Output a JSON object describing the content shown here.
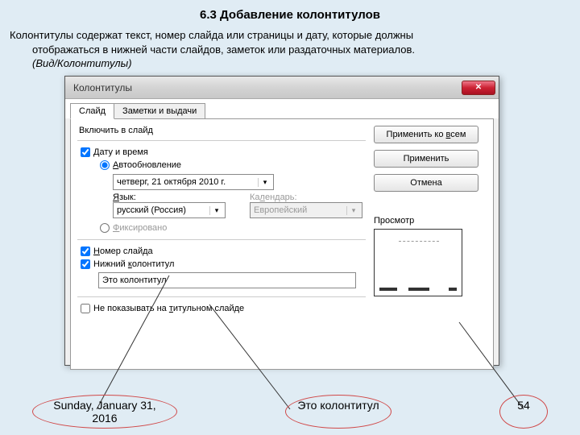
{
  "section_title": "6.3 Добавление колонтитулов",
  "description_line1": "Колонтитулы содержат текст, номер слайда или страницы и дату, которые должны",
  "description_line2": "отображаться в нижней части слайдов, заметок или раздаточных материалов.",
  "description_line3": "(Вид/Колонтитулы)",
  "dialog": {
    "title": "Колонтитулы",
    "tabs": {
      "slide": "Слайд",
      "notes": "Заметки и выдачи"
    },
    "include_label": "Включить в слайд",
    "date_time_label": "Дату и время",
    "auto_label": "Автообновление",
    "date_value": "четверг, 21 октября 2010 г.",
    "lang_label": "Язык:",
    "lang_value": "русский (Россия)",
    "calendar_label": "Календарь:",
    "calendar_value": "Европейский",
    "fixed_label": "Фиксировано",
    "slide_number_label": "Номер слайда",
    "footer_label": "Нижний колонтитул",
    "footer_value": "Это колонтитул",
    "dont_show_title_label": "Не показывать на титульном слайде",
    "apply_all": "Применить ко всем",
    "apply": "Применить",
    "cancel": "Отмена",
    "preview_label": "Просмотр"
  },
  "footer": {
    "date": "Sunday, January 31, 2016",
    "center": "Это колонтитул",
    "page": "54"
  }
}
